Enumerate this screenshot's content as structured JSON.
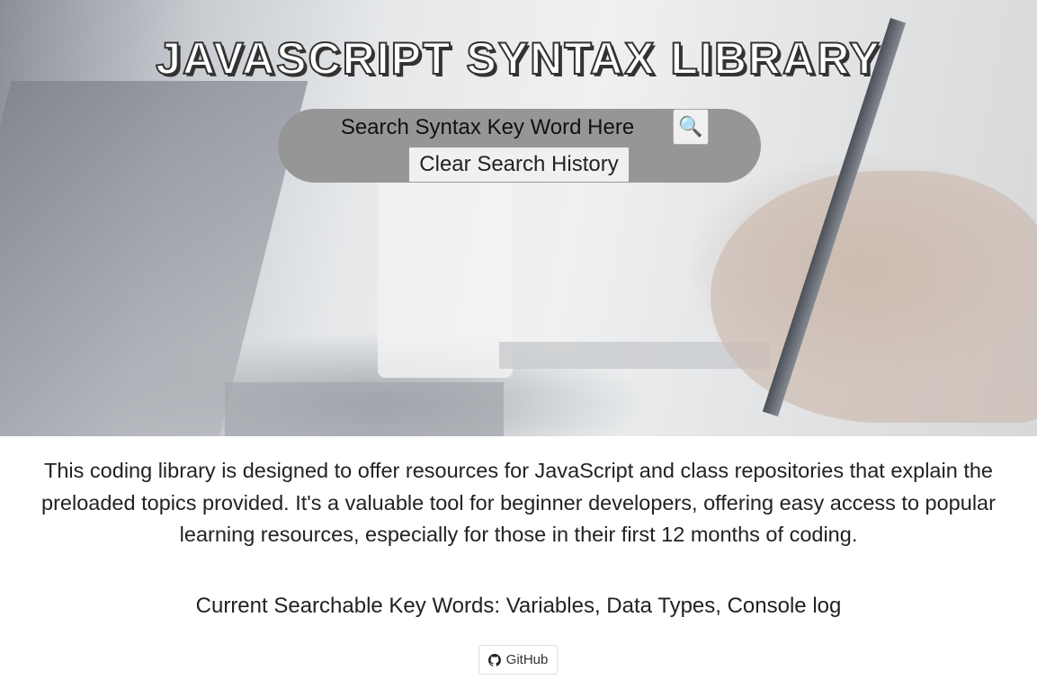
{
  "header": {
    "title": "JAVASCRIPT SYNTAX LIBRARY"
  },
  "search": {
    "placeholder": "Search Syntax Key Word Here",
    "search_icon": "magnifier-icon",
    "clear_label": "Clear Search History"
  },
  "main": {
    "description": "This coding library is designed to offer resources for JavaScript and class repositories that explain the preloaded topics provided. It's a valuable tool for beginner developers, offering easy access to popular learning resources, especially for those in their first 12 months of coding.",
    "keywords": "Current Searchable Key Words: Variables, Data Types, Console log"
  },
  "footer": {
    "github_label": "GitHub",
    "github_icon": "github-icon"
  }
}
